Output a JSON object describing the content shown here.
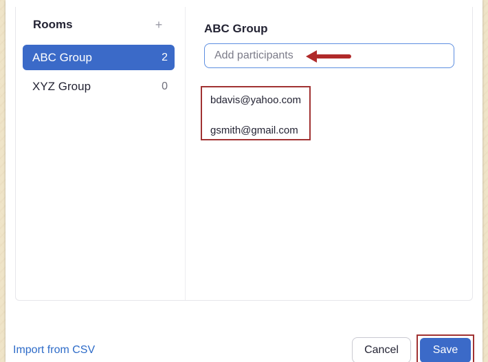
{
  "rooms": {
    "title": "Rooms",
    "add_icon": "+",
    "items": [
      {
        "label": "ABC Group",
        "count": "2",
        "selected": true
      },
      {
        "label": "XYZ Group",
        "count": "0",
        "selected": false
      }
    ]
  },
  "group": {
    "title": "ABC Group",
    "input_placeholder": "Add participants",
    "participants": [
      "bdavis@yahoo.com",
      "gsmith@gmail.com"
    ]
  },
  "footer": {
    "import_label": "Import from CSV",
    "cancel_label": "Cancel",
    "save_label": "Save"
  },
  "colors": {
    "accent": "#3b6ac8",
    "highlight_border": "#a03131",
    "arrow": "#b02a2a",
    "link": "#2d6bc8"
  },
  "icons": {
    "add_room": "plus-icon",
    "annotation": "arrow-left-icon"
  }
}
